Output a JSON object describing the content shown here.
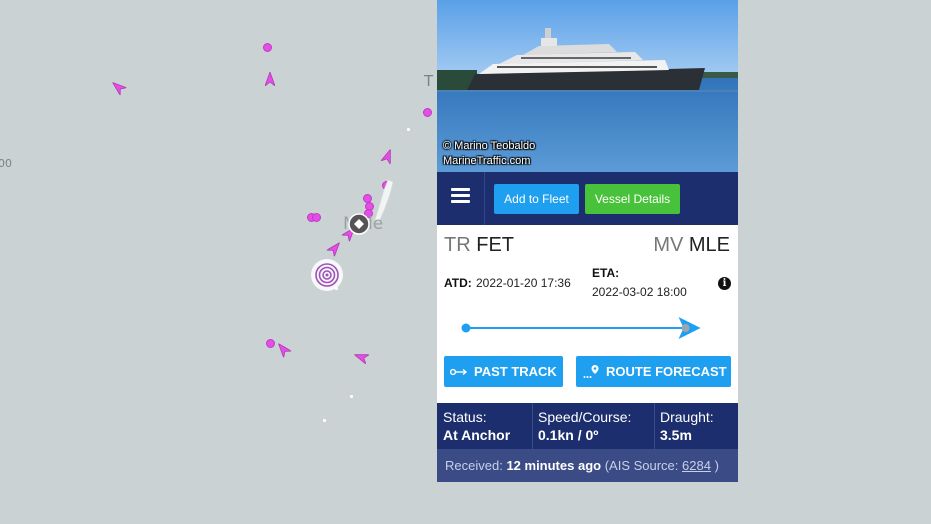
{
  "map": {
    "left_label": "00",
    "top_label": "T",
    "port_label": "Male"
  },
  "panel": {
    "photo_credit_line1": "© Marino Teobaldo",
    "photo_credit_line2": "MarineTraffic.com",
    "toolbar": {
      "add_to_fleet": "Add to Fleet",
      "vessel_details": "Vessel Details"
    },
    "origin": {
      "country": "TR",
      "code": "FET"
    },
    "destination": {
      "country": "MV",
      "code": "MLE"
    },
    "atd_label": "ATD:",
    "atd_value": "2022-01-20 17:36",
    "eta_label": "ETA:",
    "eta_value": "2022-03-02 18:00",
    "voyage_progress": 0.92,
    "past_track": "PAST TRACK",
    "route_forecast": "ROUTE FORECAST",
    "status_label": "Status:",
    "status_value": "At Anchor",
    "speed_label": "Speed/Course:",
    "speed_value": "0.1kn / 0º",
    "draught_label": "Draught:",
    "draught_value": "3.5m",
    "received_label": "Received:",
    "received_value": "12 minutes ago",
    "ais_label": "(AIS Source:",
    "ais_value": "6284",
    "ais_close": ")"
  },
  "colors": {
    "accent_blue": "#1f9ff0",
    "accent_green": "#48c23a",
    "navy": "#1c2e6e",
    "ship_magenta": "#e34ee6"
  }
}
